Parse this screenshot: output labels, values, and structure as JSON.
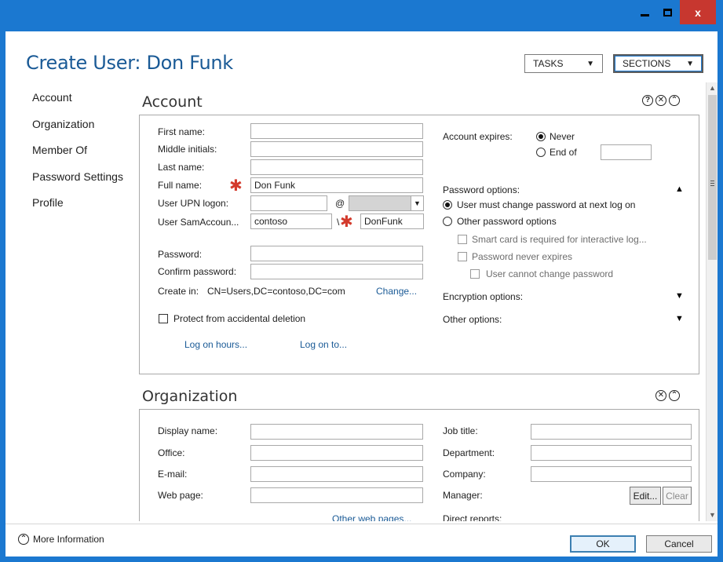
{
  "window": {
    "close_glyph": "x"
  },
  "header": {
    "title": "Create User: Don Funk",
    "tasks_label": "TASKS",
    "sections_label": "SECTIONS"
  },
  "nav": [
    "Account",
    "Organization",
    "Member Of",
    "Password Settings",
    "Profile"
  ],
  "account": {
    "title": "Account",
    "first_name_label": "First name:",
    "middle_initials_label": "Middle initials:",
    "last_name_label": "Last name:",
    "full_name_label": "Full name:",
    "full_name_value": "Don Funk",
    "upn_label": "User UPN logon:",
    "at_sign": "@",
    "sam_label": "User SamAccoun...",
    "sam_domain": "contoso",
    "sam_sep": "\\",
    "sam_value": "DonFunk",
    "password_label": "Password:",
    "confirm_label": "Confirm password:",
    "create_in_label": "Create in:",
    "create_in_value": "CN=Users,DC=contoso,DC=com",
    "change_link": "Change...",
    "protect_label": "Protect from accidental deletion",
    "log_on_hours": "Log on hours...",
    "log_on_to": "Log on to...",
    "expires_label": "Account expires:",
    "never_label": "Never",
    "end_of_label": "End of",
    "password_options_label": "Password options:",
    "must_change_label": "User must change password at next log on",
    "other_pw_label": "Other password options",
    "smart_card_label": "Smart card is required for interactive log...",
    "never_expires_label": "Password never expires",
    "cannot_change_label": "User cannot change password",
    "encryption_label": "Encryption options:",
    "other_options_label": "Other options:"
  },
  "organization": {
    "title": "Organization",
    "display_name_label": "Display name:",
    "office_label": "Office:",
    "email_label": "E-mail:",
    "web_page_label": "Web page:",
    "other_web_link": "Other web pages...",
    "job_title_label": "Job title:",
    "department_label": "Department:",
    "company_label": "Company:",
    "manager_label": "Manager:",
    "edit_label": "Edit...",
    "clear_label": "Clear",
    "direct_reports_label": "Direct reports:"
  },
  "footer": {
    "more_info": "More Information",
    "ok": "OK",
    "cancel": "Cancel"
  },
  "colors": {
    "accent": "#1b78d0",
    "title": "#1a5a96",
    "required": "#d33a2c",
    "close": "#c7372f"
  }
}
